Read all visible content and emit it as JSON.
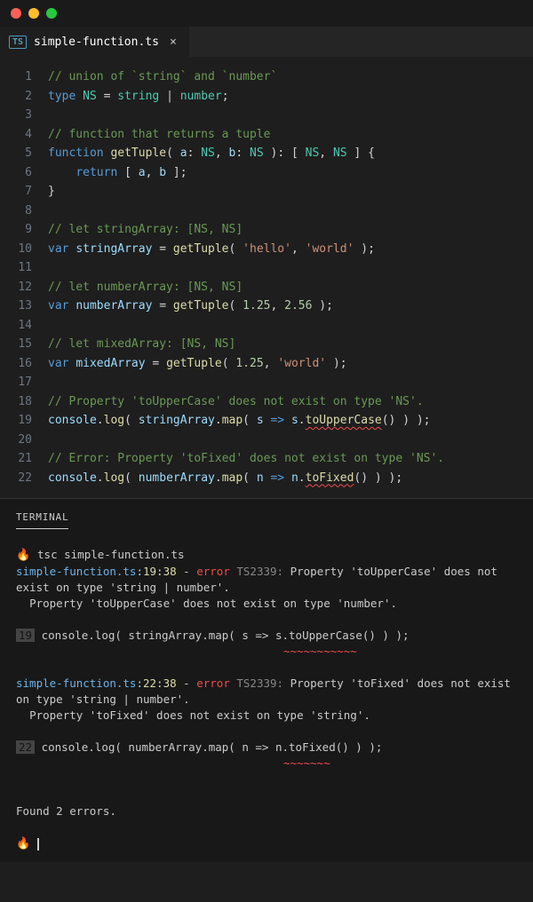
{
  "tab": {
    "icon": "TS",
    "filename": "simple-function.ts"
  },
  "lines": [
    {
      "n": 1,
      "tokens": [
        {
          "t": "// union of `string` and `number`",
          "c": "c-comment"
        }
      ]
    },
    {
      "n": 2,
      "tokens": [
        {
          "t": "type",
          "c": "c-keyword"
        },
        {
          "t": " "
        },
        {
          "t": "NS",
          "c": "c-type"
        },
        {
          "t": " = "
        },
        {
          "t": "string",
          "c": "c-type"
        },
        {
          "t": " | "
        },
        {
          "t": "number",
          "c": "c-type"
        },
        {
          "t": ";",
          "c": "c-punct"
        }
      ]
    },
    {
      "n": 3,
      "tokens": []
    },
    {
      "n": 4,
      "tokens": [
        {
          "t": "// function that returns a tuple",
          "c": "c-comment"
        }
      ]
    },
    {
      "n": 5,
      "tokens": [
        {
          "t": "function",
          "c": "c-keyword"
        },
        {
          "t": " "
        },
        {
          "t": "getTuple",
          "c": "c-func"
        },
        {
          "t": "( "
        },
        {
          "t": "a",
          "c": "c-param"
        },
        {
          "t": ": "
        },
        {
          "t": "NS",
          "c": "c-type"
        },
        {
          "t": ", "
        },
        {
          "t": "b",
          "c": "c-param"
        },
        {
          "t": ": "
        },
        {
          "t": "NS",
          "c": "c-type"
        },
        {
          "t": " ): [ "
        },
        {
          "t": "NS",
          "c": "c-type"
        },
        {
          "t": ", "
        },
        {
          "t": "NS",
          "c": "c-type"
        },
        {
          "t": " ] {",
          "c": "c-punct"
        }
      ]
    },
    {
      "n": 6,
      "tokens": [
        {
          "t": "    "
        },
        {
          "t": "return",
          "c": "c-keyword"
        },
        {
          "t": " [ "
        },
        {
          "t": "a",
          "c": "c-param"
        },
        {
          "t": ", "
        },
        {
          "t": "b",
          "c": "c-param"
        },
        {
          "t": " ];",
          "c": "c-punct"
        }
      ]
    },
    {
      "n": 7,
      "tokens": [
        {
          "t": "}",
          "c": "c-punct"
        }
      ]
    },
    {
      "n": 8,
      "tokens": []
    },
    {
      "n": 9,
      "tokens": [
        {
          "t": "// let stringArray: [NS, NS]",
          "c": "c-comment"
        }
      ]
    },
    {
      "n": 10,
      "tokens": [
        {
          "t": "var",
          "c": "c-keyword"
        },
        {
          "t": " "
        },
        {
          "t": "stringArray",
          "c": "c-object"
        },
        {
          "t": " = "
        },
        {
          "t": "getTuple",
          "c": "c-func"
        },
        {
          "t": "( "
        },
        {
          "t": "'hello'",
          "c": "c-string"
        },
        {
          "t": ", "
        },
        {
          "t": "'world'",
          "c": "c-string"
        },
        {
          "t": " );",
          "c": "c-punct"
        }
      ]
    },
    {
      "n": 11,
      "tokens": []
    },
    {
      "n": 12,
      "tokens": [
        {
          "t": "// let numberArray: [NS, NS]",
          "c": "c-comment"
        }
      ]
    },
    {
      "n": 13,
      "tokens": [
        {
          "t": "var",
          "c": "c-keyword"
        },
        {
          "t": " "
        },
        {
          "t": "numberArray",
          "c": "c-object"
        },
        {
          "t": " = "
        },
        {
          "t": "getTuple",
          "c": "c-func"
        },
        {
          "t": "( "
        },
        {
          "t": "1.25",
          "c": "c-number"
        },
        {
          "t": ", "
        },
        {
          "t": "2.56",
          "c": "c-number"
        },
        {
          "t": " );",
          "c": "c-punct"
        }
      ]
    },
    {
      "n": 14,
      "tokens": []
    },
    {
      "n": 15,
      "tokens": [
        {
          "t": "// let mixedArray: [NS, NS]",
          "c": "c-comment"
        }
      ]
    },
    {
      "n": 16,
      "tokens": [
        {
          "t": "var",
          "c": "c-keyword"
        },
        {
          "t": " "
        },
        {
          "t": "mixedArray",
          "c": "c-object"
        },
        {
          "t": " = "
        },
        {
          "t": "getTuple",
          "c": "c-func"
        },
        {
          "t": "( "
        },
        {
          "t": "1.25",
          "c": "c-number"
        },
        {
          "t": ", "
        },
        {
          "t": "'world'",
          "c": "c-string"
        },
        {
          "t": " );",
          "c": "c-punct"
        }
      ]
    },
    {
      "n": 17,
      "tokens": []
    },
    {
      "n": 18,
      "tokens": [
        {
          "t": "// Property 'toUpperCase' does not exist on type 'NS'.",
          "c": "c-comment"
        }
      ]
    },
    {
      "n": 19,
      "tokens": [
        {
          "t": "console",
          "c": "c-object"
        },
        {
          "t": "."
        },
        {
          "t": "log",
          "c": "c-func"
        },
        {
          "t": "( "
        },
        {
          "t": "stringArray",
          "c": "c-object"
        },
        {
          "t": "."
        },
        {
          "t": "map",
          "c": "c-func"
        },
        {
          "t": "( "
        },
        {
          "t": "s",
          "c": "c-param"
        },
        {
          "t": " "
        },
        {
          "t": "=>",
          "c": "c-keyword"
        },
        {
          "t": " "
        },
        {
          "t": "s",
          "c": "c-param"
        },
        {
          "t": "."
        },
        {
          "t": "toUpperCase",
          "c": "c-func squiggle"
        },
        {
          "t": "() ) );",
          "c": "c-punct"
        }
      ]
    },
    {
      "n": 20,
      "tokens": []
    },
    {
      "n": 21,
      "tokens": [
        {
          "t": "// Error: Property 'toFixed' does not exist on type 'NS'.",
          "c": "c-comment"
        }
      ]
    },
    {
      "n": 22,
      "tokens": [
        {
          "t": "console",
          "c": "c-object"
        },
        {
          "t": "."
        },
        {
          "t": "log",
          "c": "c-func"
        },
        {
          "t": "( "
        },
        {
          "t": "numberArray",
          "c": "c-object"
        },
        {
          "t": "."
        },
        {
          "t": "map",
          "c": "c-func"
        },
        {
          "t": "( "
        },
        {
          "t": "n",
          "c": "c-param"
        },
        {
          "t": " "
        },
        {
          "t": "=>",
          "c": "c-keyword"
        },
        {
          "t": " "
        },
        {
          "t": "n",
          "c": "c-param"
        },
        {
          "t": "."
        },
        {
          "t": "toFixed",
          "c": "c-func squiggle"
        },
        {
          "t": "() ) );",
          "c": "c-punct"
        }
      ]
    }
  ],
  "terminal": {
    "tab_label": "TERMINAL",
    "prompt_icon": "🔥",
    "command": "tsc simple-function.ts",
    "errors": [
      {
        "file": "simple-function.ts",
        "loc": "19:38",
        "sep": " - ",
        "error_word": "error",
        "code": " TS2339:",
        "msg_head": " Property 'toUpperCase' does not exist on type 'string | number'.",
        "msg_detail": "  Property 'toUpperCase' does not exist on type 'number'.",
        "snippet_n": "19",
        "snippet_code": " console.log( stringArray.map( s => s.toUpperCase() ) );",
        "squiggle_pad": "                                      ",
        "squiggle": "~~~~~~~~~~~"
      },
      {
        "file": "simple-function.ts",
        "loc": "22:38",
        "sep": " - ",
        "error_word": "error",
        "code": " TS2339:",
        "msg_head": " Property 'toFixed' does not exist on type 'string | number'.",
        "msg_detail": "  Property 'toFixed' does not exist on type 'string'.",
        "snippet_n": "22",
        "snippet_code": " console.log( numberArray.map( n => n.toFixed() ) );",
        "squiggle_pad": "                                      ",
        "squiggle": "~~~~~~~"
      }
    ],
    "summary": "Found 2 errors."
  }
}
